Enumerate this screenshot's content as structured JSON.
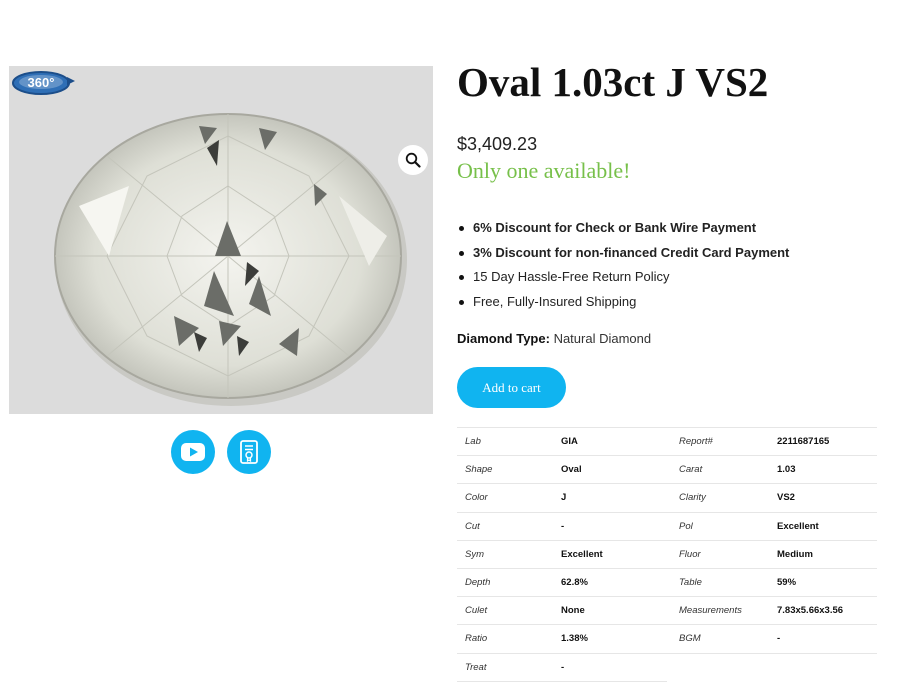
{
  "product": {
    "title": "Oval 1.03ct J VS2",
    "price": "$3,409.23",
    "stock": "Only one available!"
  },
  "gallery": {
    "badge": "360°",
    "zoom_icon": "magnifier-icon",
    "buttons": [
      {
        "icon": "youtube-play-icon"
      },
      {
        "icon": "certificate-icon"
      }
    ]
  },
  "perks": [
    "6% Discount for Check or Bank Wire Payment",
    "3% Discount for non-financed Credit Card Payment",
    "15 Day Hassle-Free Return Policy",
    "Free, Fully-Insured Shipping"
  ],
  "diamond_type": {
    "label": "Diamond Type:",
    "value": "Natural Diamond"
  },
  "add_to_cart": "Add to cart",
  "colors": {
    "accent": "#10b4f0",
    "stock": "#77c04a"
  },
  "specs": [
    {
      "l1": "Lab",
      "v1": "GIA",
      "l2": "Report#",
      "v2": "2211687165"
    },
    {
      "l1": "Shape",
      "v1": "Oval",
      "l2": "Carat",
      "v2": "1.03"
    },
    {
      "l1": "Color",
      "v1": "J",
      "l2": "Clarity",
      "v2": "VS2"
    },
    {
      "l1": "Cut",
      "v1": "-",
      "l2": "Pol",
      "v2": "Excellent"
    },
    {
      "l1": "Sym",
      "v1": "Excellent",
      "l2": "Fluor",
      "v2": "Medium"
    },
    {
      "l1": "Depth",
      "v1": "62.8%",
      "l2": "Table",
      "v2": "59%"
    },
    {
      "l1": "Culet",
      "v1": "None",
      "l2": "Measurements",
      "v2": "7.83x5.66x3.56"
    },
    {
      "l1": "Ratio",
      "v1": "1.38%",
      "l2": "BGM",
      "v2": "-"
    },
    {
      "l1": "Treat",
      "v1": "-"
    }
  ]
}
